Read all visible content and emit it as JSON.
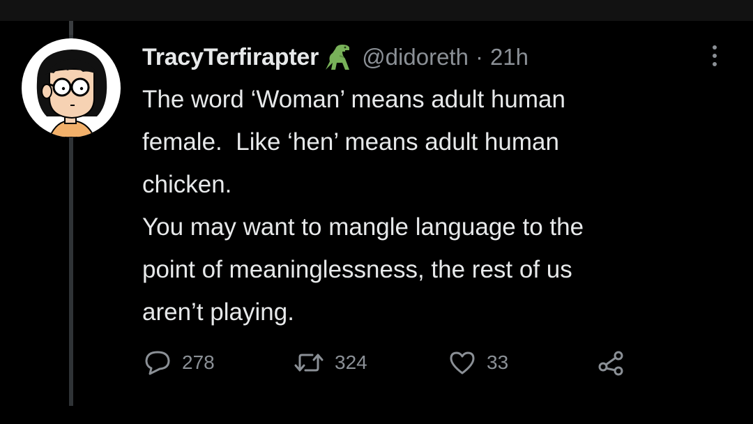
{
  "tweet": {
    "display_name": "TracyTerfirapter",
    "emoji_icon": "t-rex-icon",
    "handle": "@didoreth",
    "separator": "·",
    "time": "21h",
    "text": "The word ‘Woman’ means adult human\nfemale.  Like ‘hen’ means adult human\nchicken.\nYou may want to mangle language to the\npoint of meaninglessness, the rest of us\naren’t playing."
  },
  "actions": {
    "reply_count": "278",
    "retweet_count": "324",
    "like_count": "33"
  },
  "icons": {
    "reply": "speech-bubble-icon",
    "retweet": "retweet-arrows-icon",
    "like": "heart-icon",
    "share": "share-icon",
    "more": "vertical-dots-icon"
  },
  "colors": {
    "background": "#000000",
    "text": "#e7e9ea",
    "secondary_text": "#8b9096",
    "dino_green": "#78b159"
  }
}
